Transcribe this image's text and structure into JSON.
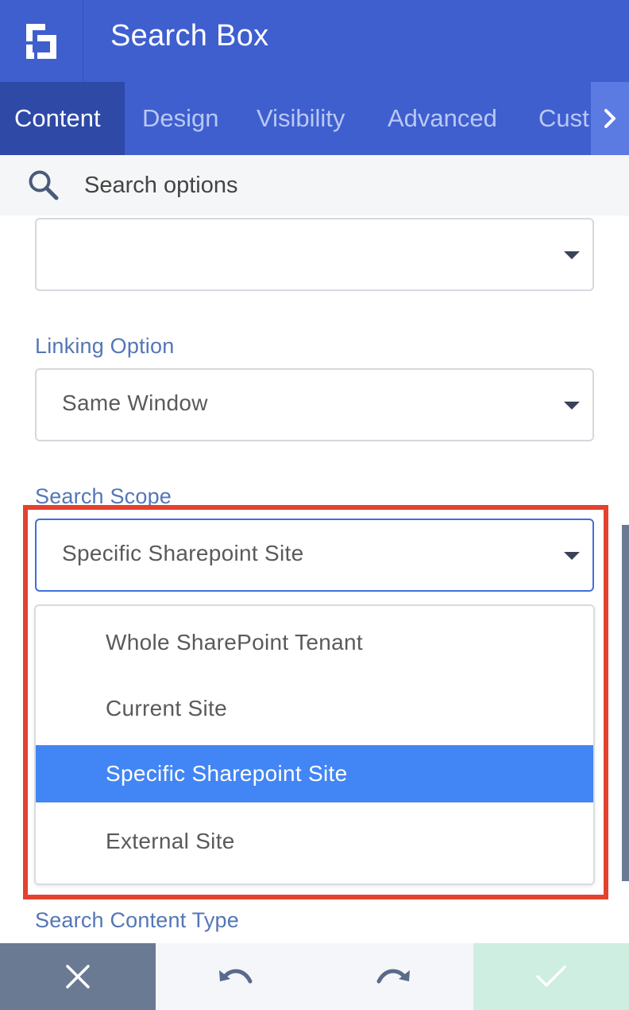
{
  "header": {
    "title": "Search Box",
    "logo_icon": "builder-logo-icon"
  },
  "tabs": [
    {
      "label": "Content",
      "active": true
    },
    {
      "label": "Design",
      "active": false
    },
    {
      "label": "Visibility",
      "active": false
    },
    {
      "label": "Advanced",
      "active": false
    },
    {
      "label": "Cust",
      "active": false
    }
  ],
  "search": {
    "placeholder": "Search options",
    "value": ""
  },
  "form": {
    "top_select": {
      "value": ""
    },
    "linking_option": {
      "label": "Linking Option",
      "value": "Same Window"
    },
    "search_scope": {
      "label": "Search Scope",
      "value": "Specific Sharepoint Site",
      "options": [
        {
          "label": "Whole SharePoint Tenant",
          "selected": false
        },
        {
          "label": "Current Site",
          "selected": false
        },
        {
          "label": "Specific Sharepoint Site",
          "selected": true
        },
        {
          "label": "External Site",
          "selected": false
        }
      ]
    },
    "search_content_type": {
      "label": "Search Content Type"
    }
  },
  "footer": {
    "close_icon": "close-icon",
    "undo_icon": "undo-icon",
    "redo_icon": "redo-icon",
    "confirm_icon": "check-icon"
  },
  "colors": {
    "header_bg": "#3f5fcf",
    "active_tab_bg": "#2e49a6",
    "label_blue": "#5476b8",
    "selected_option_bg": "#4285f4",
    "highlight_border": "#e4412f",
    "confirm_bg": "#cdeee0",
    "close_bg": "#6b7a93"
  }
}
